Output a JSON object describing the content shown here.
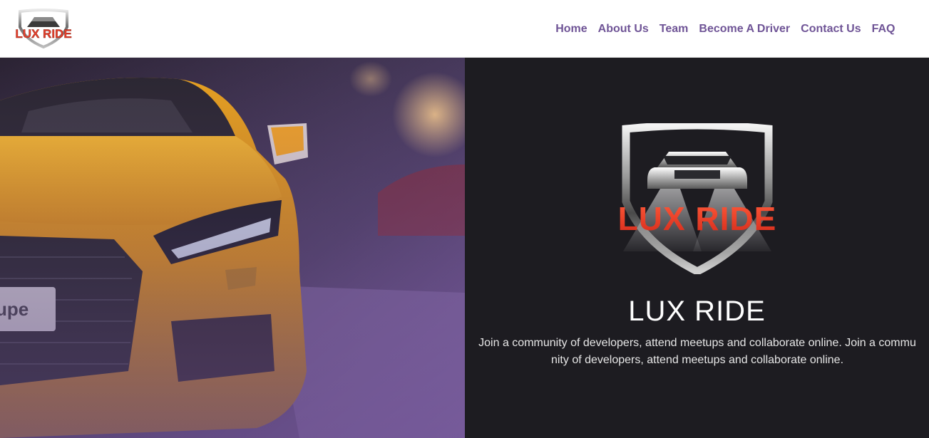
{
  "brand": {
    "logo_text": "LUX RIDE",
    "accent_color": "#e8412c",
    "nav_color": "#6f5496",
    "logo_icon": "car-shield-icon"
  },
  "nav": {
    "items": [
      {
        "label": "Home"
      },
      {
        "label": "About Us"
      },
      {
        "label": "Team"
      },
      {
        "label": "Become A Driver"
      },
      {
        "label": "Contact Us"
      },
      {
        "label": "FAQ"
      }
    ]
  },
  "hero": {
    "image": "yellow-sports-car-photo",
    "logo_text": "LUX RIDE",
    "title": "LUX RIDE",
    "description": "Join a community of developers, attend meetups and collaborate online. Join a community of developers, attend meetups and collaborate online.",
    "panel_color": "#1d1c21"
  }
}
